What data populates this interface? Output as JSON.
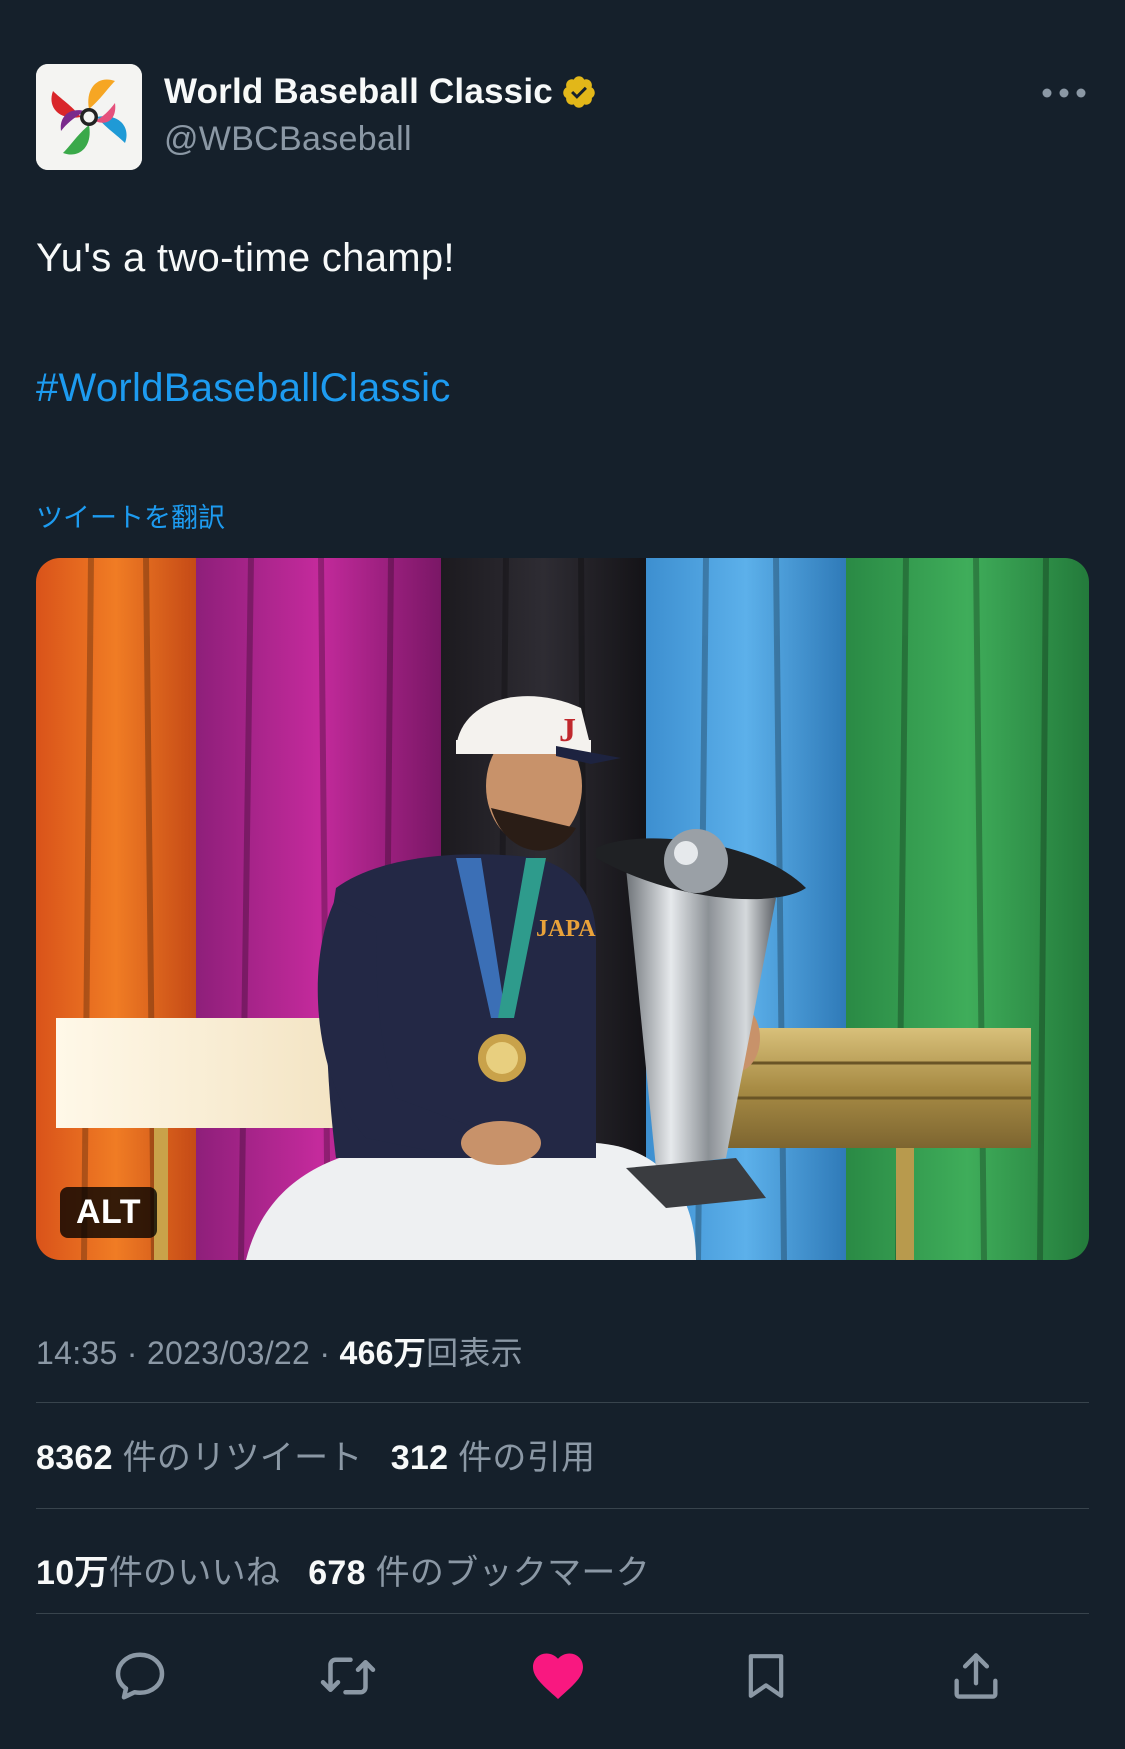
{
  "account": {
    "display_name": "World Baseball Classic",
    "handle": "@WBCBaseball",
    "verified_icon": "verified-badge-icon",
    "verified_color": "#e2b719"
  },
  "tweet": {
    "text": "Yu's a two-time champ!",
    "hashtag": "#WorldBaseballClassic",
    "translate_label": "ツイートを翻訳"
  },
  "media": {
    "alt_label": "ALT"
  },
  "meta": {
    "time": "14:35",
    "separator": "·",
    "date": "2023/03/22",
    "views_count": "466万",
    "views_label": "回表示"
  },
  "stats": {
    "retweets_count": "8362",
    "retweets_label": "件のリツイート",
    "quotes_count": "312",
    "quotes_label": "件の引用",
    "likes_count": "10万",
    "likes_label": "件のいいね",
    "bookmarks_count": "678",
    "bookmarks_label": "件のブックマーク"
  },
  "actions": {
    "reply_icon": "reply-icon",
    "retweet_icon": "retweet-icon",
    "like_icon": "heart-icon",
    "bookmark_icon": "bookmark-icon",
    "share_icon": "share-icon",
    "like_color": "#f91880"
  },
  "colors": {
    "background": "#15202b",
    "link": "#1d9bf0",
    "secondary_text": "#8b98a5"
  }
}
